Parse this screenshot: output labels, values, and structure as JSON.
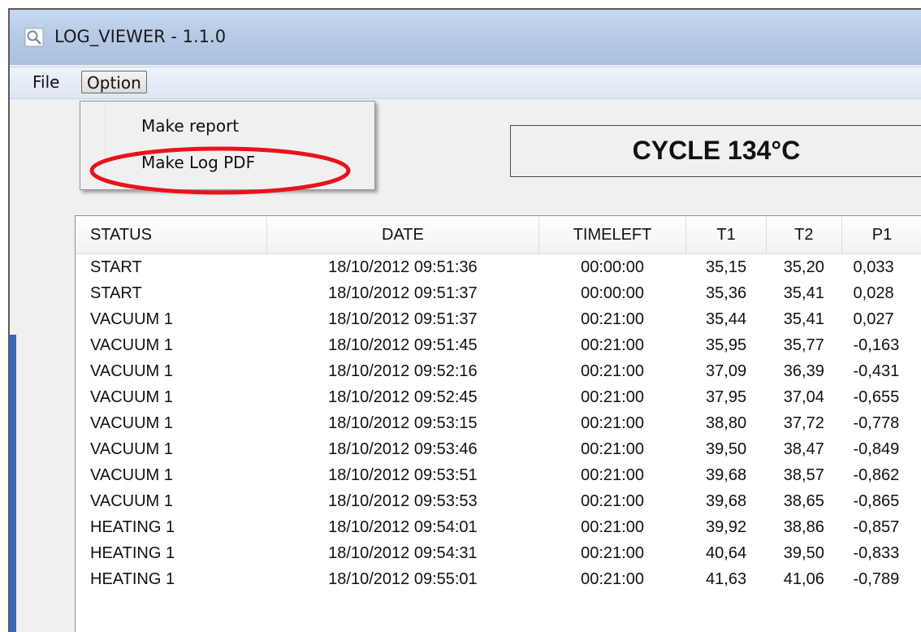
{
  "window": {
    "title": "LOG_VIEWER - 1.1.0"
  },
  "menu": {
    "items": [
      {
        "label": "File"
      },
      {
        "label": "Option"
      }
    ],
    "option_dropdown": [
      {
        "label": "Make report"
      },
      {
        "label": "Make Log PDF"
      }
    ]
  },
  "cycle": {
    "label": "CYCLE 134°C"
  },
  "table": {
    "headers": [
      "STATUS",
      "DATE",
      "TIMELEFT",
      "T1",
      "T2",
      "P1"
    ],
    "rows": [
      [
        "START",
        "18/10/2012 09:51:36",
        "00:00:00",
        "35,15",
        "35,20",
        "0,033"
      ],
      [
        "START",
        "18/10/2012 09:51:37",
        "00:00:00",
        "35,36",
        "35,41",
        "0,028"
      ],
      [
        "VACUUM 1",
        "18/10/2012 09:51:37",
        "00:21:00",
        "35,44",
        "35,41",
        "0,027"
      ],
      [
        "VACUUM 1",
        "18/10/2012 09:51:45",
        "00:21:00",
        "35,95",
        "35,77",
        "-0,163"
      ],
      [
        "VACUUM 1",
        "18/10/2012 09:52:16",
        "00:21:00",
        "37,09",
        "36,39",
        "-0,431"
      ],
      [
        "VACUUM 1",
        "18/10/2012 09:52:45",
        "00:21:00",
        "37,95",
        "37,04",
        "-0,655"
      ],
      [
        "VACUUM 1",
        "18/10/2012 09:53:15",
        "00:21:00",
        "38,80",
        "37,72",
        "-0,778"
      ],
      [
        "VACUUM 1",
        "18/10/2012 09:53:46",
        "00:21:00",
        "39,50",
        "38,47",
        "-0,849"
      ],
      [
        "VACUUM 1",
        "18/10/2012 09:53:51",
        "00:21:00",
        "39,68",
        "38,57",
        "-0,862"
      ],
      [
        "VACUUM 1",
        "18/10/2012 09:53:53",
        "00:21:00",
        "39,68",
        "38,65",
        "-0,865"
      ],
      [
        "HEATING 1",
        "18/10/2012 09:54:01",
        "00:21:00",
        "39,92",
        "38,86",
        "-0,857"
      ],
      [
        "HEATING 1",
        "18/10/2012 09:54:31",
        "00:21:00",
        "40,64",
        "39,50",
        "-0,833"
      ],
      [
        "HEATING 1",
        "18/10/2012 09:55:01",
        "00:21:00",
        "41,63",
        "41,06",
        "-0,789"
      ]
    ]
  },
  "icons": {
    "app": "magnifier-icon"
  },
  "colors": {
    "highlight": "#e8141b",
    "accent": "#3a66b8"
  }
}
